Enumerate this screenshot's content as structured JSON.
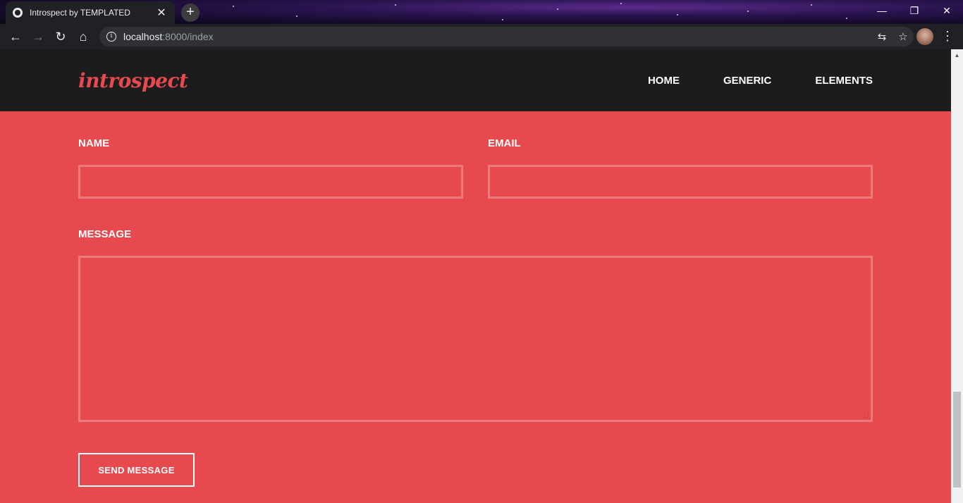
{
  "browser": {
    "tab_title": "Introspect by TEMPLATED",
    "tab_close": "✕",
    "new_tab": "+",
    "url_host": "localhost",
    "url_path": ":8000/index",
    "win_minimize": "—",
    "win_restore": "❐",
    "win_close": "✕",
    "back": "←",
    "forward": "→",
    "reload": "↻",
    "home": "⌂",
    "translate": "⇆",
    "bookmark": "☆",
    "menu": "⋮"
  },
  "site": {
    "logo": "introspect",
    "nav": [
      "HOME",
      "GENERIC",
      "ELEMENTS"
    ],
    "accent_color": "#e64a4e",
    "header_color": "#1c1c1c"
  },
  "form": {
    "name_label": "NAME",
    "email_label": "EMAIL",
    "message_label": "MESSAGE",
    "name_value": "",
    "email_value": "",
    "message_value": "",
    "send_label": "SEND MESSAGE"
  }
}
